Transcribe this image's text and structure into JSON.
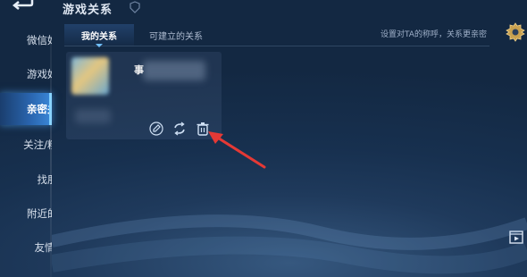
{
  "header": {
    "title": "游戏关系"
  },
  "sidebar": {
    "items": [
      {
        "label": "微信好友"
      },
      {
        "label": "游戏好友"
      },
      {
        "label": "亲密关系"
      },
      {
        "label": "关注/粉丝"
      },
      {
        "label": "找朋友"
      },
      {
        "label": "附近的人"
      },
      {
        "label": "友情重燃"
      }
    ],
    "active_index": 2
  },
  "tabs": [
    {
      "label": "我的关系"
    },
    {
      "label": "可建立的关系"
    }
  ],
  "hint": "设置对TA的称呼，关系更亲密",
  "card": {
    "name_visible": "事"
  },
  "icons": {
    "back": "back-arrow-icon",
    "settings": "settings-gear-icon",
    "actions": [
      "edit-relation-icon",
      "swap-relation-icon",
      "delete-trash-icon"
    ],
    "video": "video-icon"
  },
  "colors": {
    "accent": "#3a88d8",
    "annotation_arrow": "#e53935"
  }
}
